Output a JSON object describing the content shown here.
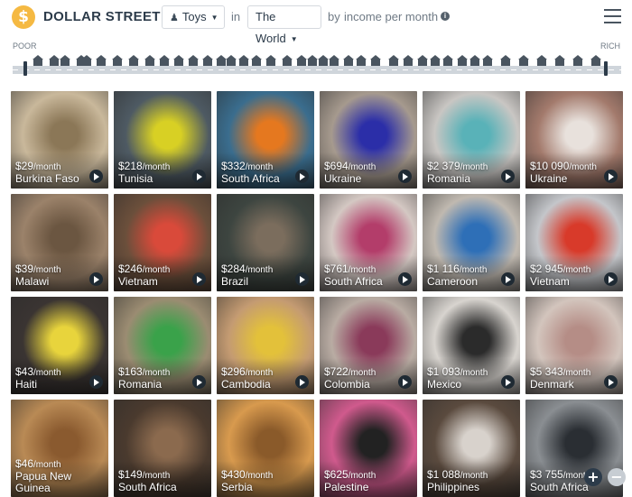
{
  "brand": {
    "logo_glyph": "$",
    "title": "DOLLAR STREET"
  },
  "filters": {
    "topic": "Toys",
    "in_label": "in",
    "place": "The World",
    "by_label": "by",
    "income_label": "income per month",
    "info_glyph": "i"
  },
  "street": {
    "poor_label": "POOR",
    "rich_label": "RICH"
  },
  "zoom": {
    "in_glyph": "+",
    "out_glyph": "−"
  },
  "tiles": [
    {
      "amount": "$29",
      "unit": "/month",
      "country": "Burkina Faso",
      "colors": [
        "#c9b89b",
        "#8b7757"
      ]
    },
    {
      "amount": "$218",
      "unit": "/month",
      "country": "Tunisia",
      "colors": [
        "#4e5a63",
        "#d8d024"
      ]
    },
    {
      "amount": "$332",
      "unit": "/month",
      "country": "South Africa",
      "colors": [
        "#3a6d8e",
        "#e5781f"
      ]
    },
    {
      "amount": "$694",
      "unit": "/month",
      "country": "Ukraine",
      "colors": [
        "#a69a8e",
        "#2b2ea8"
      ]
    },
    {
      "amount": "$2 379",
      "unit": "/month",
      "country": "Romania",
      "colors": [
        "#c9c6c3",
        "#59b2b8"
      ]
    },
    {
      "amount": "$10 090",
      "unit": "/month",
      "country": "Ukraine",
      "colors": [
        "#a37a6c",
        "#e8e1dc"
      ]
    },
    {
      "amount": "$39",
      "unit": "/month",
      "country": "Malawi",
      "colors": [
        "#9b826a",
        "#6b5641"
      ]
    },
    {
      "amount": "$246",
      "unit": "/month",
      "country": "Vietnam",
      "colors": [
        "#6b4f3b",
        "#d94a3a"
      ]
    },
    {
      "amount": "$284",
      "unit": "/month",
      "country": "Brazil",
      "colors": [
        "#3d4540",
        "#7b6d5d"
      ]
    },
    {
      "amount": "$761",
      "unit": "/month",
      "country": "South Africa",
      "colors": [
        "#d4c8c3",
        "#b33d6a"
      ]
    },
    {
      "amount": "$1 116",
      "unit": "/month",
      "country": "Cameroon",
      "colors": [
        "#c0b9b0",
        "#2e6fb7"
      ]
    },
    {
      "amount": "$2 945",
      "unit": "/month",
      "country": "Vietnam",
      "colors": [
        "#c4c6ca",
        "#d83a2a"
      ]
    },
    {
      "amount": "$43",
      "unit": "/month",
      "country": "Haiti",
      "colors": [
        "#3a3432",
        "#e8d43c"
      ]
    },
    {
      "amount": "$163",
      "unit": "/month",
      "country": "Romania",
      "colors": [
        "#9b8c72",
        "#3aa24a"
      ]
    },
    {
      "amount": "$296",
      "unit": "/month",
      "country": "Cambodia",
      "colors": [
        "#c49b72",
        "#e3c13a"
      ]
    },
    {
      "amount": "$722",
      "unit": "/month",
      "country": "Colombia",
      "colors": [
        "#b9aca3",
        "#8a3a5a"
      ]
    },
    {
      "amount": "$1 093",
      "unit": "/month",
      "country": "Mexico",
      "colors": [
        "#d8d4cf",
        "#2b2b2b"
      ]
    },
    {
      "amount": "$5 343",
      "unit": "/month",
      "country": "Denmark",
      "colors": [
        "#d3c5bd",
        "#b58d86"
      ]
    },
    {
      "amount": "$46",
      "unit": "/month",
      "country": "Papua New Guinea",
      "colors": [
        "#b98a55",
        "#8a5a2f"
      ]
    },
    {
      "amount": "$149",
      "unit": "/month",
      "country": "South Africa",
      "colors": [
        "#4a3a2e",
        "#8b6a4e"
      ]
    },
    {
      "amount": "$430",
      "unit": "/month",
      "country": "Serbia",
      "colors": [
        "#d89a4e",
        "#8a5a2a"
      ]
    },
    {
      "amount": "$625",
      "unit": "/month",
      "country": "Palestine",
      "colors": [
        "#d05a8d",
        "#222222"
      ]
    },
    {
      "amount": "$1 088",
      "unit": "/month",
      "country": "Philippines",
      "colors": [
        "#5a4a3e",
        "#d8d2cc"
      ]
    },
    {
      "amount": "$3 755",
      "unit": "/month",
      "country": "South Africa",
      "colors": [
        "#8a8e92",
        "#2a2e33"
      ]
    }
  ]
}
